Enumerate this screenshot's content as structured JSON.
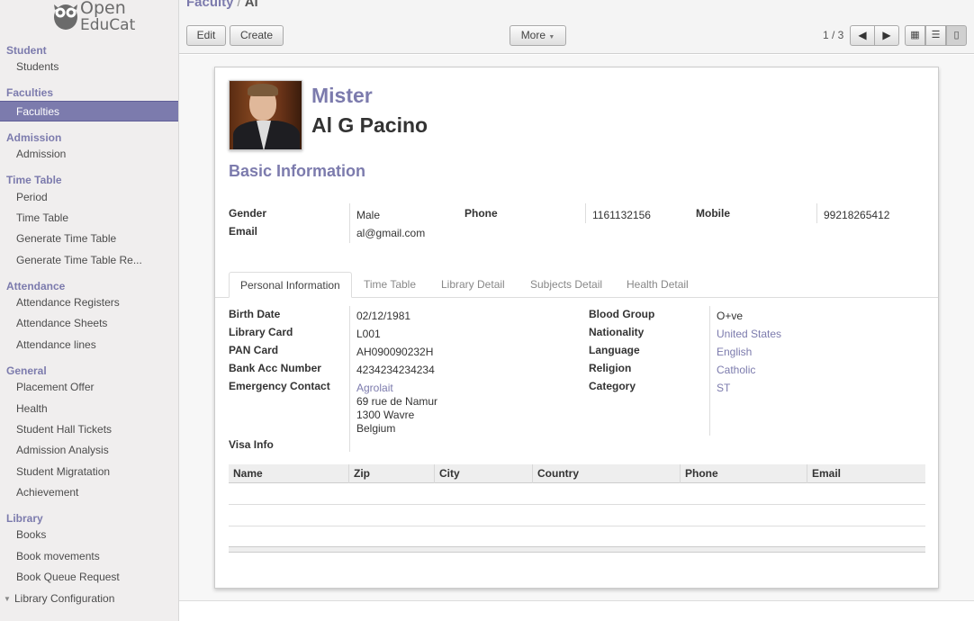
{
  "logo": {
    "line1": "Open",
    "line2": "EduCat"
  },
  "sidebar": {
    "sections": [
      {
        "title": "Student",
        "items": [
          {
            "label": "Students"
          }
        ]
      },
      {
        "title": "Faculties",
        "items": [
          {
            "label": "Faculties",
            "active": true
          }
        ]
      },
      {
        "title": "Admission",
        "items": [
          {
            "label": "Admission"
          }
        ]
      },
      {
        "title": "Time Table",
        "items": [
          {
            "label": "Period"
          },
          {
            "label": "Time Table"
          },
          {
            "label": "Generate Time Table"
          },
          {
            "label": "Generate Time Table Re..."
          }
        ]
      },
      {
        "title": "Attendance",
        "items": [
          {
            "label": "Attendance Registers"
          },
          {
            "label": "Attendance Sheets"
          },
          {
            "label": "Attendance lines"
          }
        ]
      },
      {
        "title": "General",
        "items": [
          {
            "label": "Placement Offer"
          },
          {
            "label": "Health"
          },
          {
            "label": "Student Hall Tickets"
          },
          {
            "label": "Admission Analysis"
          },
          {
            "label": "Student Migratation"
          },
          {
            "label": "Achievement"
          }
        ]
      },
      {
        "title": "Library",
        "items": [
          {
            "label": "Books"
          },
          {
            "label": "Book movements"
          },
          {
            "label": "Book Queue Request"
          },
          {
            "label": "Library Configuration"
          }
        ]
      }
    ]
  },
  "header": {
    "breadcrumb_parent": "Faculty",
    "breadcrumb_sep": "/",
    "breadcrumb_current": "Al",
    "edit_label": "Edit",
    "create_label": "Create",
    "more_label": "More",
    "pager": "1 / 3"
  },
  "record": {
    "title": "Mister",
    "name": "Al G Pacino",
    "basic_heading": "Basic Information",
    "basic": {
      "gender_label": "Gender",
      "gender": "Male",
      "email_label": "Email",
      "email": "al@gmail.com",
      "phone_label": "Phone",
      "phone": "1161132156",
      "mobile_label": "Mobile",
      "mobile": "99218265412"
    },
    "tabs": [
      "Personal Information",
      "Time Table",
      "Library Detail",
      "Subjects Detail",
      "Health Detail"
    ],
    "personal": {
      "birth_date_label": "Birth Date",
      "birth_date": "02/12/1981",
      "library_card_label": "Library Card",
      "library_card": "L001",
      "pan_card_label": "PAN Card",
      "pan_card": "AH090090232H",
      "bank_acc_label": "Bank Acc Number",
      "bank_acc": "4234234234234",
      "emergency_label": "Emergency Contact",
      "emergency_name": "Agrolait",
      "emergency_addr1": "69 rue de Namur",
      "emergency_addr2": "1300 Wavre",
      "emergency_addr3": "Belgium",
      "visa_label": "Visa Info",
      "blood_group_label": "Blood Group",
      "blood_group": "O+ve",
      "nationality_label": "Nationality",
      "nationality": "United States",
      "language_label": "Language",
      "language": "English",
      "religion_label": "Religion",
      "religion": "Catholic",
      "category_label": "Category",
      "category": "ST"
    },
    "table_columns": [
      "Name",
      "Zip",
      "City",
      "Country",
      "Phone",
      "Email"
    ]
  },
  "colors": {
    "accent": "#7c7bad"
  }
}
